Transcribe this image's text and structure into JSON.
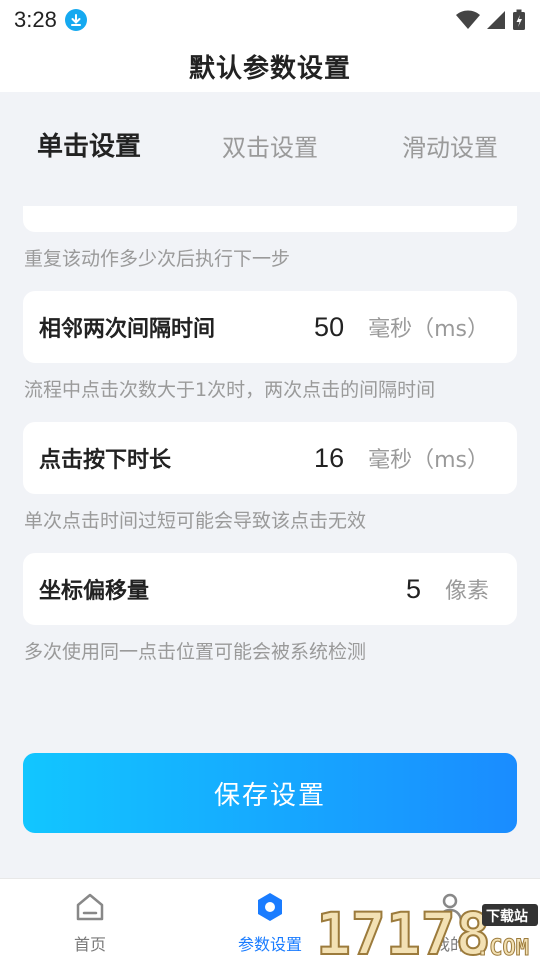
{
  "status": {
    "time": "3:28"
  },
  "header": {
    "title": "默认参数设置"
  },
  "tabs": [
    {
      "label": "单击设置",
      "active": true
    },
    {
      "label": "双击设置",
      "active": false
    },
    {
      "label": "滑动设置",
      "active": false
    }
  ],
  "settings": {
    "prev_hint": "重复该动作多少次后执行下一步",
    "interval": {
      "label": "相邻两次间隔时间",
      "value": "50",
      "unit": "毫秒（ms）",
      "hint": "流程中点击次数大于1次时，两次点击的间隔时间"
    },
    "press_duration": {
      "label": "点击按下时长",
      "value": "16",
      "unit": "毫秒（ms）",
      "hint": "单次点击时间过短可能会导致该点击无效"
    },
    "offset": {
      "label": "坐标偏移量",
      "value": "5",
      "unit": "像素",
      "hint": "多次使用同一点击位置可能会被系统检测"
    }
  },
  "actions": {
    "save_label": "保存设置"
  },
  "bottom_nav": [
    {
      "label": "首页",
      "icon": "home-icon",
      "active": false
    },
    {
      "label": "参数设置",
      "icon": "settings-hexagon-icon",
      "active": true
    },
    {
      "label": "我的",
      "icon": "profile-icon",
      "active": false
    }
  ],
  "watermark": {
    "text": "17178",
    "tag": "下载站",
    "suffix": ".COM"
  },
  "colors": {
    "accent": "#1a8cff",
    "accent_light": "#12c6ff",
    "hint": "#9a9a9a",
    "background": "#f1f3f7"
  }
}
